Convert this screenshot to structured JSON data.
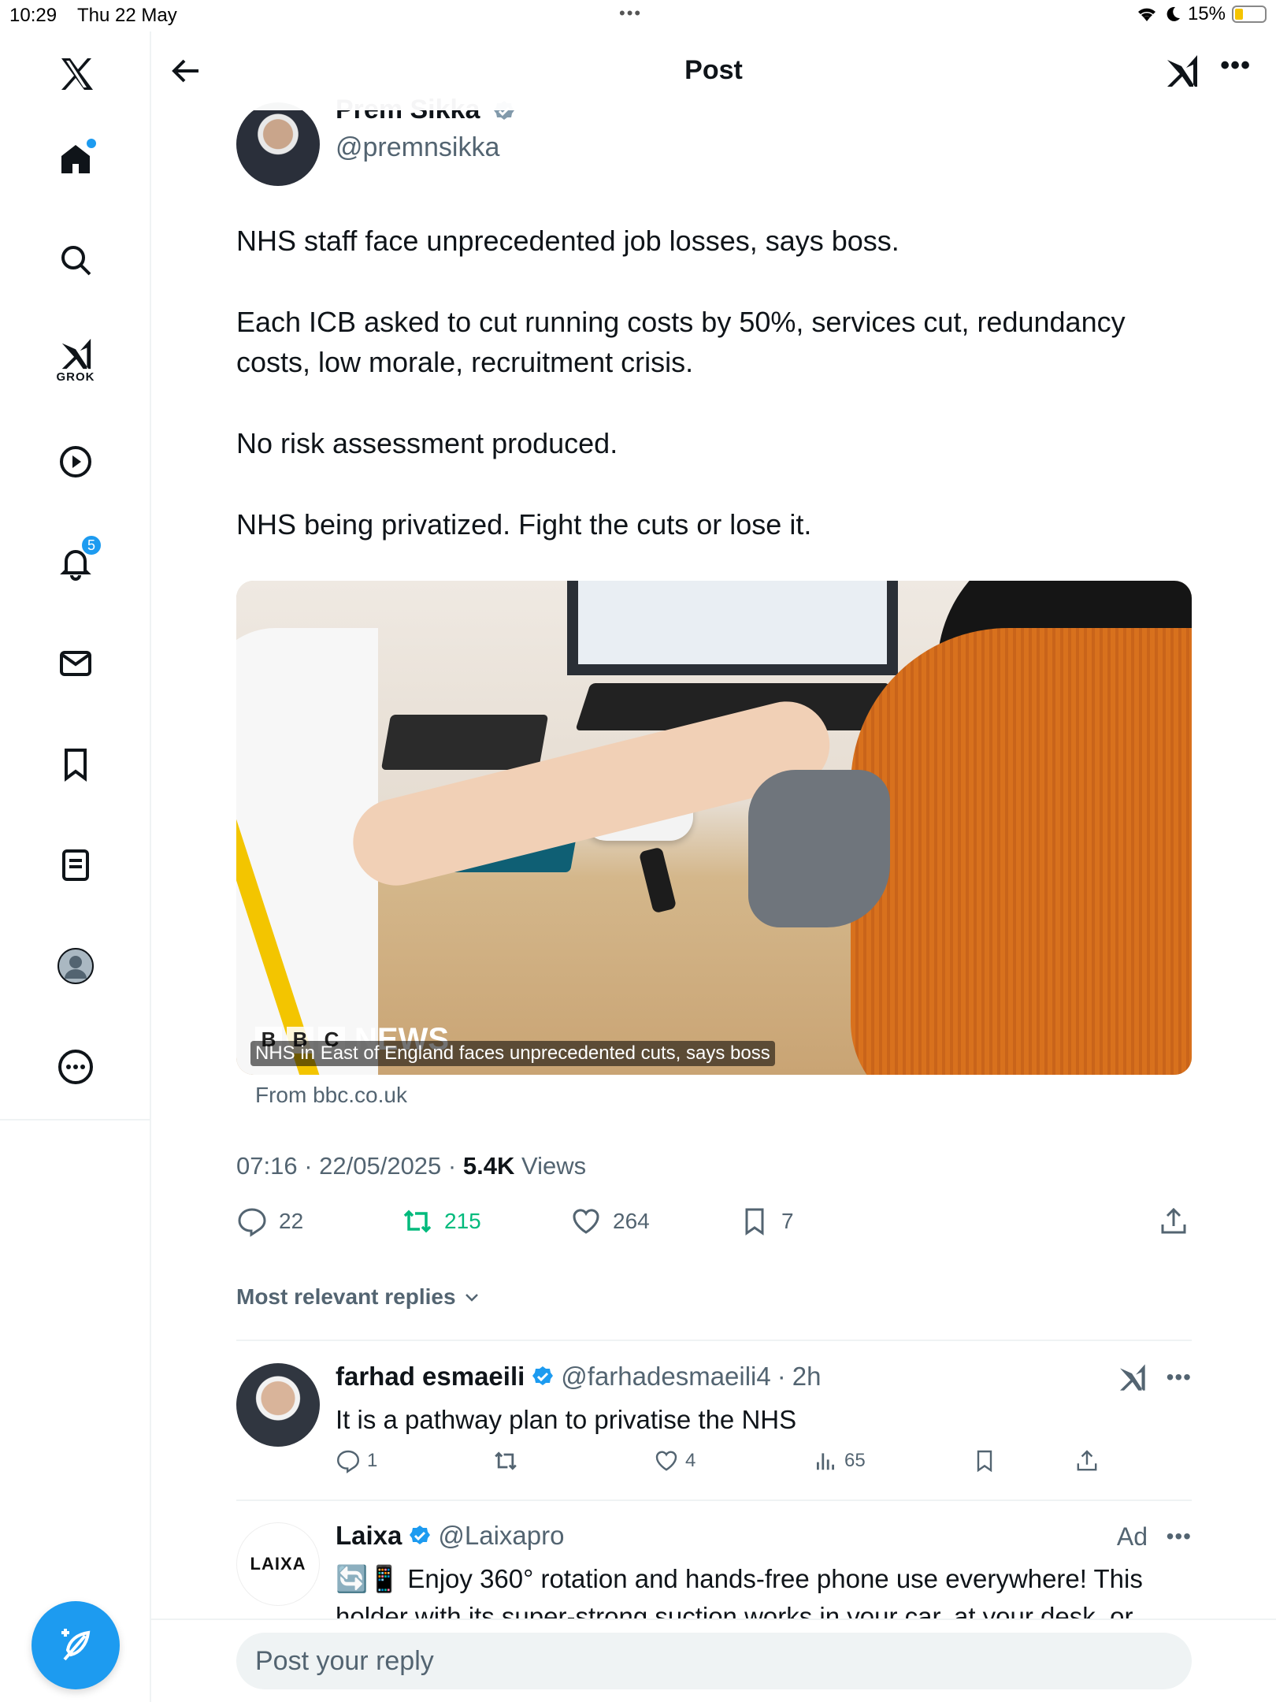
{
  "status_bar": {
    "time": "10:29",
    "date": "Thu 22 May",
    "battery": "15%"
  },
  "header": {
    "title": "Post"
  },
  "sidebar": {
    "grok_label": "GROK",
    "notifications_count": "5"
  },
  "post": {
    "author_name": "Prem Sikka",
    "author_handle": "@premnsikka",
    "paragraphs": [
      "NHS staff face unprecedented job losses, says boss.",
      "Each ICB asked to cut running costs by 50%, services cut, redundancy costs, low morale, recruitment crisis.",
      "No risk assessment produced.",
      "NHS being privatized. Fight the cuts or lose it."
    ],
    "card": {
      "logo_letters": [
        "B",
        "B",
        "C"
      ],
      "logo_word": "NEWS",
      "caption": "NHS in East of England faces unprecedented cuts, says boss",
      "source": "From bbc.co.uk"
    },
    "time": "07:16",
    "date": "22/05/2025",
    "views_count": "5.4K",
    "views_label": "Views",
    "replies": "22",
    "reposts": "215",
    "likes": "264",
    "bookmarks": "7"
  },
  "replies_filter": "Most relevant replies",
  "replies": [
    {
      "name": "farhad esmaeili",
      "handle": "@farhadesmaeili4",
      "time": "2h",
      "text": "It is a pathway plan to privatise the NHS",
      "replies": "1",
      "likes": "4",
      "views": "65"
    },
    {
      "name": "Laixa",
      "handle": "@Laixapro",
      "ad_label": "Ad",
      "logo_text": "LAIXA",
      "text": "🔄📱 Enjoy 360° rotation and hands-free phone use everywhere! This holder with its super-strong suction works in your car, at your desk, or"
    }
  ],
  "composer": {
    "placeholder": "Post your reply"
  },
  "colors": {
    "accent": "#1d9bf0",
    "repost_green": "#00ba7c",
    "muted": "#536471"
  }
}
